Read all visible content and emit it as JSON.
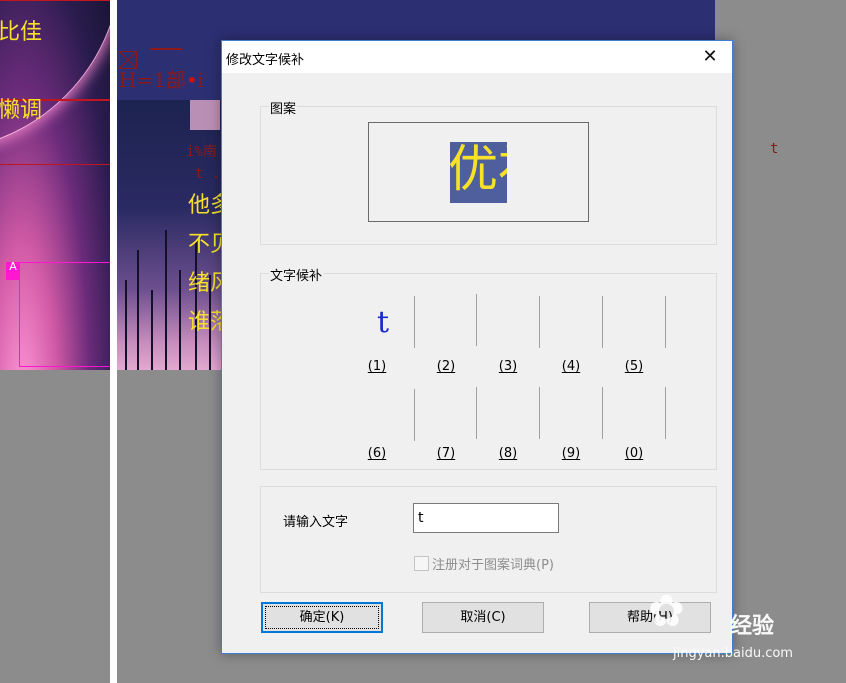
{
  "background": {
    "left_texts": [
      "比佳",
      "懒调"
    ],
    "badge": "A",
    "mid_red_text": "H=1部",
    "mid_red_text_tail": "i",
    "mono_line1": "i%南",
    "mono_line2": "t .",
    "mono_far": "t",
    "yellow_lines": [
      "他多",
      "不见",
      "绪风",
      "谁落"
    ]
  },
  "dialog": {
    "title": "修改文字候补",
    "close_glyph": "✕",
    "pattern_group_label": "图案",
    "pattern_image_text": "优补",
    "candidates_group_label": "文字候补",
    "candidates": [
      {
        "number": "(1)",
        "char": "t"
      },
      {
        "number": "(2)",
        "char": ""
      },
      {
        "number": "(3)",
        "char": ""
      },
      {
        "number": "(4)",
        "char": ""
      },
      {
        "number": "(5)",
        "char": ""
      },
      {
        "number": "(6)",
        "char": ""
      },
      {
        "number": "(7)",
        "char": ""
      },
      {
        "number": "(8)",
        "char": ""
      },
      {
        "number": "(9)",
        "char": ""
      },
      {
        "number": "(0)",
        "char": ""
      }
    ],
    "input_label": "请输入文字",
    "input_value": "t",
    "register_checkbox_label": "注册对于图案词典(P)",
    "register_checked": false,
    "ok_label": "确定(K)",
    "cancel_label": "取消(C)",
    "help_label": "帮助(H)"
  },
  "watermark": {
    "icon": "baidu-paw-icon",
    "brand": "经验",
    "brand_prefix": "Bai",
    "url": "jingyan.baidu.com"
  },
  "colors": {
    "accent": "#0078d7",
    "candidate_text": "#1a2acc",
    "highlight_yellow": "#f7e12a"
  }
}
